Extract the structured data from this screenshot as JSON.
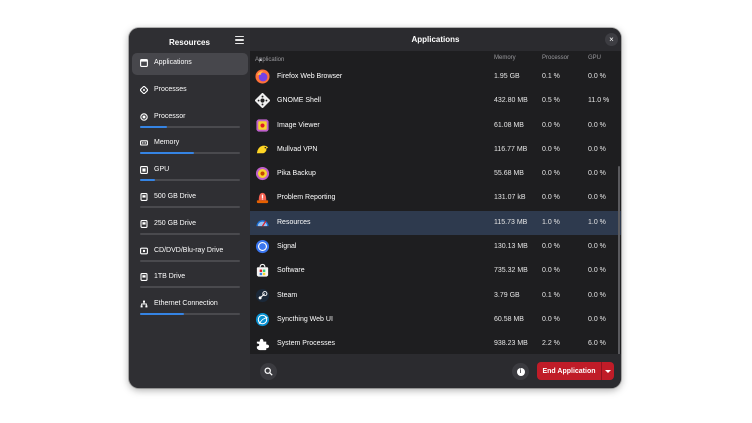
{
  "sidebar": {
    "title": "Resources",
    "menu_icon": "hamburger-menu-icon",
    "items": [
      {
        "label": "Applications",
        "icon": "window-icon",
        "active": true
      },
      {
        "label": "Processes",
        "icon": "processes-icon",
        "active": false
      },
      {
        "label": "Processor",
        "icon": "processor-icon",
        "usage": 0.27
      },
      {
        "label": "Memory",
        "icon": "memory-icon",
        "usage": 0.54
      },
      {
        "label": "GPU",
        "icon": "gpu-icon",
        "usage": 0.15
      },
      {
        "label": "500 GB Drive",
        "icon": "drive-icon",
        "usage": 0
      },
      {
        "label": "250 GB Drive",
        "icon": "drive-icon",
        "usage": 0
      },
      {
        "label": "CD/DVD/Blu-ray Drive",
        "icon": "drive-icon",
        "usage": 0
      },
      {
        "label": "1TB Drive",
        "icon": "drive-icon",
        "usage": 0
      },
      {
        "label": "Ethernet Connection",
        "icon": "network-icon",
        "usage": 0.44
      }
    ]
  },
  "main": {
    "title": "Applications",
    "close_label": "×",
    "columns": {
      "application": "Application",
      "memory": "Memory",
      "processor": "Processor",
      "gpu": "GPU"
    },
    "rows": [
      {
        "name": "Firefox Web Browser",
        "memory": "1.95 GB",
        "processor": "0.1 %",
        "gpu": "0.0 %",
        "icon": "firefox-icon",
        "color": "#ff7139"
      },
      {
        "name": "GNOME Shell",
        "memory": "432.80 MB",
        "processor": "0.5 %",
        "gpu": "11.0 %",
        "icon": "gnome-shell-icon",
        "color": "#f0f0f0"
      },
      {
        "name": "Image Viewer",
        "memory": "61.08 MB",
        "processor": "0.0 %",
        "gpu": "0.0 %",
        "icon": "image-viewer-icon",
        "color": "#c061cb"
      },
      {
        "name": "Mullvad VPN",
        "memory": "116.77 MB",
        "processor": "0.0 %",
        "gpu": "0.0 %",
        "icon": "mullvad-icon",
        "color": "#ffd524"
      },
      {
        "name": "Pika Backup",
        "memory": "55.68 MB",
        "processor": "0.0 %",
        "gpu": "0.0 %",
        "icon": "pika-backup-icon",
        "color": "#c64600"
      },
      {
        "name": "Problem Reporting",
        "memory": "131.07 kB",
        "processor": "0.0 %",
        "gpu": "0.0 %",
        "icon": "problem-reporting-icon",
        "color": "#e66100"
      },
      {
        "name": "Resources",
        "memory": "115.73 MB",
        "processor": "1.0 %",
        "gpu": "1.0 %",
        "icon": "resources-icon",
        "color": "#3584e4",
        "selected": true
      },
      {
        "name": "Signal",
        "memory": "130.13 MB",
        "processor": "0.0 %",
        "gpu": "0.0 %",
        "icon": "signal-icon",
        "color": "#3a76f0"
      },
      {
        "name": "Software",
        "memory": "735.32 MB",
        "processor": "0.0 %",
        "gpu": "0.0 %",
        "icon": "software-icon",
        "color": "#f6f5f4"
      },
      {
        "name": "Steam",
        "memory": "3.79 GB",
        "processor": "0.1 %",
        "gpu": "0.0 %",
        "icon": "steam-icon",
        "color": "#1b2838"
      },
      {
        "name": "Syncthing Web UI",
        "memory": "60.58 MB",
        "processor": "0.0 %",
        "gpu": "0.0 %",
        "icon": "syncthing-icon",
        "color": "#0891d1"
      },
      {
        "name": "System Processes",
        "memory": "938.23 MB",
        "processor": "2.2 %",
        "gpu": "6.0 %",
        "icon": "system-processes-icon",
        "color": "#ffffff"
      }
    ]
  },
  "bottom": {
    "search_icon": "search-icon",
    "info_icon": "info-icon",
    "info_glyph": "i",
    "end_label": "End Application",
    "end_color": "#c01c28"
  }
}
